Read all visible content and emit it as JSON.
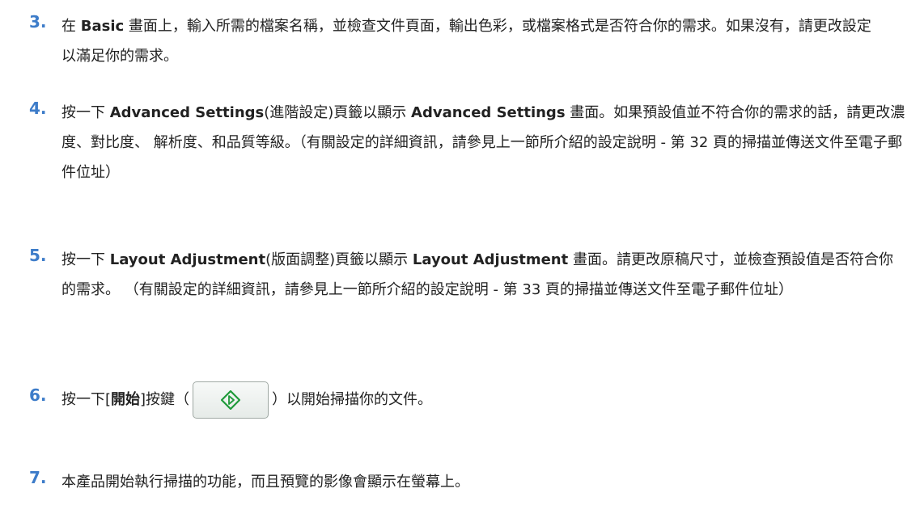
{
  "steps": [
    {
      "number": "3.",
      "t1": "在 ",
      "b1": "Basic",
      "t2": " 畫面上，輸入所需的檔案名稱，並檢查文件頁面，輸出色彩，或檔案格式是否符合你的需求。如果沒有，請更改設定以滿足你的需求。"
    },
    {
      "number": "4.",
      "t1": "按一下 ",
      "b1": "Advanced Settings",
      "t2": "(進階設定)頁籤以顯示 ",
      "b2": "Advanced Settings",
      "t3": " 畫面。如果預設值並不符合你的需求的話，請更改濃度、對比度、 解析度、和品質等級。（有關設定的詳細資訊，請參見上一節所介紹的設定說明 - 第 32 頁的掃描並傳送文件至電子郵件位址）"
    },
    {
      "number": "5.",
      "t1": "按一下 ",
      "b1": "Layout Adjustment",
      "t2": "(版面調整)頁籤以顯示 ",
      "b2": "Layout Adjustment",
      "t3": " 畫面。請更改原稿尺寸，並檢查預設值是否符合你的需求。 （有關設定的詳細資訊，請參見上一節所介紹的設定說明 - 第 33 頁的掃描並傳送文件至電子郵件位址）"
    },
    {
      "number": "6.",
      "t1": "按一下[",
      "b1": "開始",
      "t2": "]按鍵（",
      "t3": "）以開始掃描你的文件。",
      "start_icon_color": "#1f9a3a"
    },
    {
      "number": "7.",
      "t1": "本產品開始執行掃描的功能，而且預覽的影像會顯示在螢幕上。"
    }
  ]
}
